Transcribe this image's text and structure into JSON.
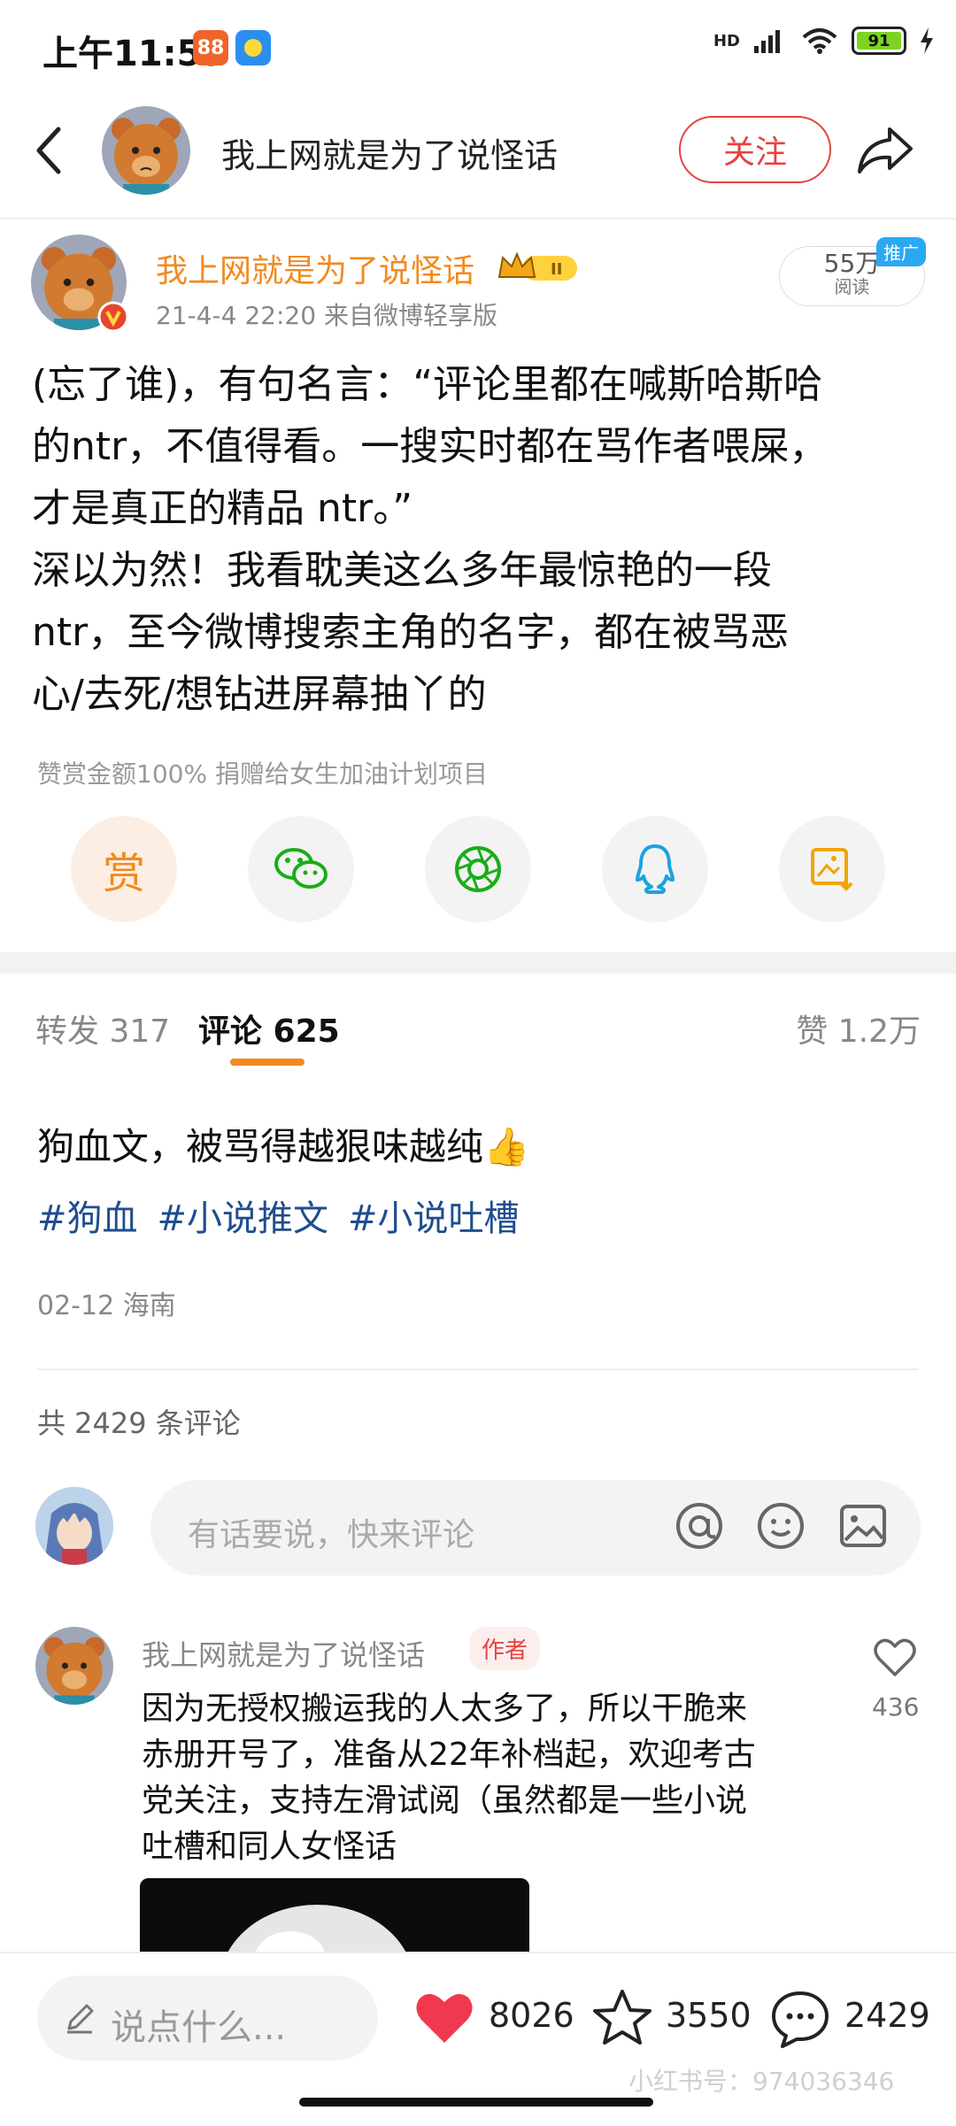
{
  "status_bar": {
    "time": "上午11:59",
    "app_icon_1": "88",
    "battery": "91",
    "network": "HD",
    "icons": [
      "signal-icon",
      "wifi-icon",
      "battery-icon",
      "charging-icon"
    ]
  },
  "header": {
    "title": "我上网就是为了说怪话",
    "follow_label": "关注"
  },
  "post": {
    "author": "我上网就是为了说怪话",
    "meta": "21-4-4 22:20  来自微博轻享版",
    "reads_count": "55万",
    "reads_label": "阅读",
    "promo_badge": "推广",
    "body_lines": [
      "(忘了谁)，有句名言：“评论里都在喊斯哈斯哈",
      "的ntr，不值得看。一搜实时都在骂作者喂屎，",
      "才是真正的精品 ntr。”",
      "深以为然！我看耽美这么多年最惊艳的一段",
      "ntr，至今微博搜索主角的名字，都在被骂恶",
      "心/去死/想钻进屏幕抽丫的"
    ],
    "reward_note": "赞赏金额100% 捐赠给女生加油计划项目",
    "share_reward_label": "赏"
  },
  "tabs": {
    "repost": "转发 317",
    "comment": "评论 625",
    "like": "赞 1.2万"
  },
  "note": {
    "text": "狗血文，被骂得越狠味越纯👍",
    "tags": [
      "#狗血",
      "#小说推文",
      "#小说吐槽"
    ],
    "date_location": "02-12 海南",
    "total_comments": "共 2429 条评论"
  },
  "comment_input": {
    "placeholder": "有话要说，快来评论"
  },
  "comments": [
    {
      "author": "我上网就是为了说怪话",
      "tag": "作者",
      "lines": [
        "因为无授权搬运我的人太多了，所以干脆来",
        "赤册开号了，准备从22年补档起，欢迎考古",
        "党关注，支持左滑试阅（虽然都是一些小说",
        "吐槽和同人女怪话"
      ],
      "likes": "436"
    }
  ],
  "bottom_bar": {
    "say_placeholder": "说点什么...",
    "likes": "8026",
    "collects": "3550",
    "comments": "2429",
    "watermark": "小红书号：974036346"
  },
  "colors": {
    "accent_orange": "#f28a1e",
    "follow_red": "#e7423f",
    "tag_blue": "#1f4d8f",
    "heart_red": "#f0394e"
  }
}
